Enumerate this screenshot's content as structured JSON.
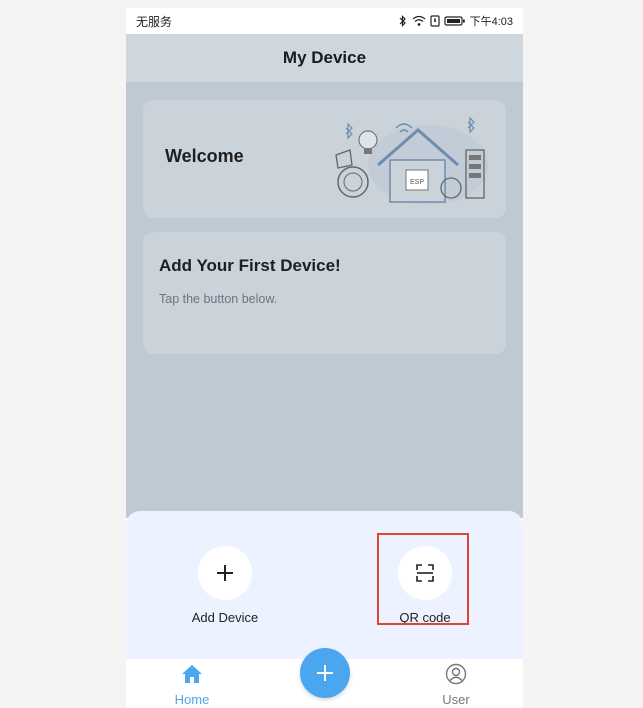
{
  "status_bar": {
    "carrier": "无服务",
    "time": "下午4:03"
  },
  "header": {
    "title": "My Device"
  },
  "cards": {
    "welcome": {
      "title": "Welcome",
      "illustration_label": "ESP"
    },
    "first_device": {
      "title": "Add Your First Device!",
      "subtitle": "Tap the button below."
    }
  },
  "sheet": {
    "actions": [
      {
        "label": "Add Device",
        "icon": "plus-icon"
      },
      {
        "label": "QR code",
        "icon": "qr-scan-icon"
      }
    ]
  },
  "tabbar": {
    "home_label": "Home",
    "user_label": "User"
  },
  "colors": {
    "accent": "#4aa7ef",
    "highlight": "#e24434",
    "sheet_bg": "#ecf2ff"
  }
}
